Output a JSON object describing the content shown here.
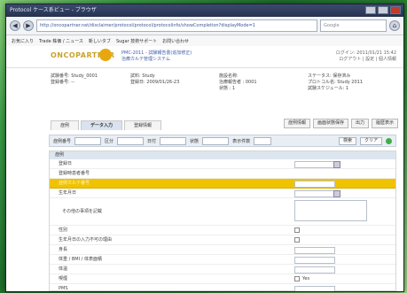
{
  "window": {
    "title": "Protocol ケース系ビュー - ブラウザ"
  },
  "browser": {
    "address": "http://oncopartner.net/disclaimer/protocol/protocol/protocolinfo/showCompletion?displayMode=1",
    "search_placeholder": "Google",
    "bookmarks": [
      "お気に入り",
      "Trade 株価 / ニュース",
      "新しいタブ",
      "Sugar 技術サポート",
      "お問い合わせ"
    ]
  },
  "app": {
    "logo": "ONCOPARTNER",
    "header_mid": [
      "PMC-2011 - 試験報告書(追加修正)",
      "治療カルテ管理システム"
    ],
    "header_right": [
      "ログイン: 2011/01/21 15:42",
      "ログアウト | 設定 | 個人情報"
    ]
  },
  "info": {
    "cols": [
      [
        "試験番号: Study_0001",
        "登録番号: --"
      ],
      [
        "試料: Study",
        "登録日: 2009/01/26-23"
      ],
      [
        "施設名称:",
        "治療報告者 : 0001",
        "状態 : 1"
      ],
      [
        "ステータス: 保存済み",
        "プロトコル名: Study 2011",
        "試験スケジュール: 1"
      ]
    ]
  },
  "toolbar": [
    "症例情報",
    "画面状態保存",
    "出力",
    "履歴表示"
  ],
  "tabs": [
    "症例",
    "データ入力",
    "登録情報"
  ],
  "filter": {
    "labels": [
      "症例番号",
      "区分",
      "日付",
      "状態",
      "表示件数"
    ],
    "search_button": "検索",
    "clear_button": "クリア"
  },
  "form": {
    "section": "症例",
    "rows": [
      {
        "label": "登録日",
        "value": "",
        "kind": "value"
      },
      {
        "label": "登録時患者番号",
        "value": "",
        "kind": "none"
      },
      {
        "label": "症例カルテ番号",
        "value": "",
        "kind": "value",
        "highlight": true
      },
      {
        "label": "生年月日",
        "value": "",
        "kind": "value"
      },
      {
        "label": "その他の事項を記載",
        "value": "",
        "kind": "textarea"
      },
      {
        "label": "性別",
        "value": "",
        "kind": "check",
        "check_label": ""
      },
      {
        "label": "生年月日の入力不可の理由",
        "value": "",
        "kind": "check",
        "check_label": ""
      },
      {
        "label": "身長",
        "value": "",
        "kind": "value"
      },
      {
        "label": "体重 / BMI / 体表面積",
        "value": "",
        "kind": "value"
      },
      {
        "label": "体温",
        "value": "",
        "kind": "value"
      },
      {
        "label": "喫煙",
        "value": "Yes",
        "kind": "check",
        "check_label": "Yes"
      },
      {
        "label": "PMS",
        "value": "",
        "kind": "value"
      }
    ]
  },
  "colors": {
    "highlight": "#f0c300",
    "accent": "#3f5ca8",
    "logo": "#c9a32a"
  }
}
